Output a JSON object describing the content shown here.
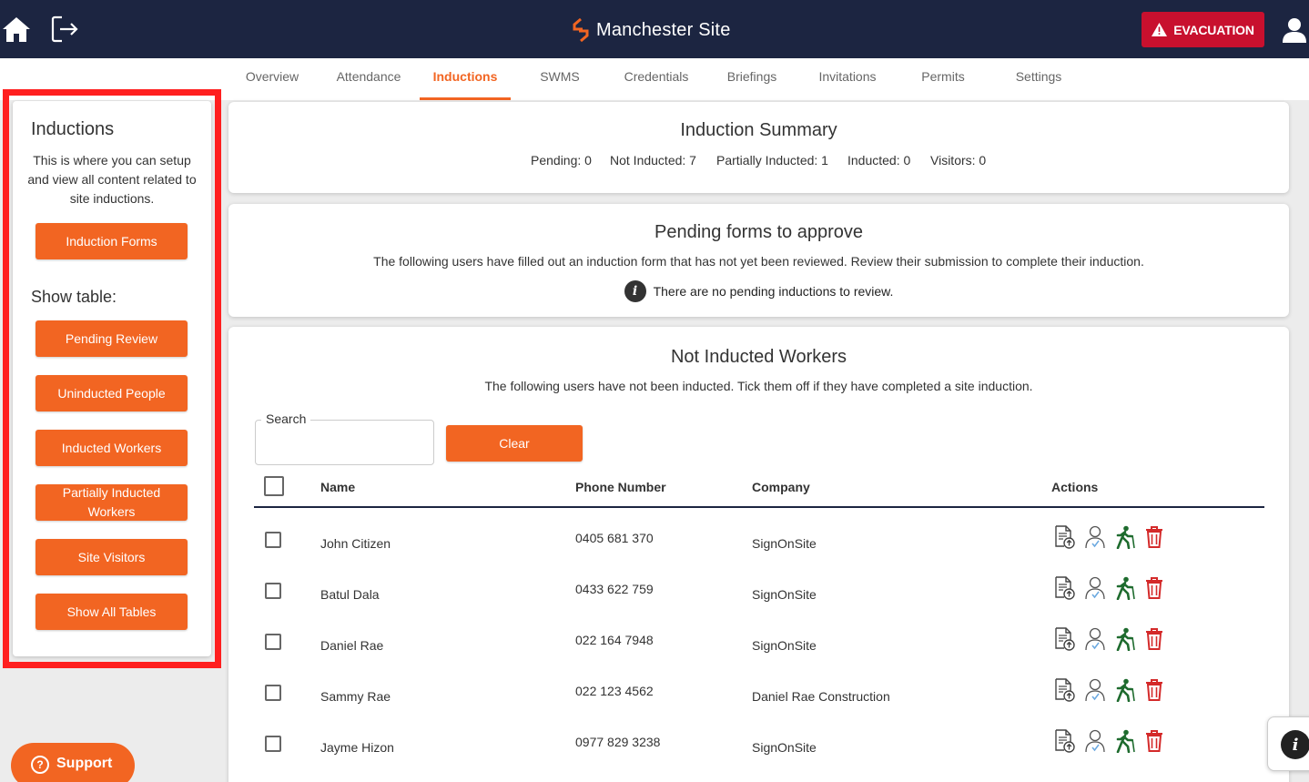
{
  "header": {
    "site_title": "Manchester Site",
    "evacuation_label": "EVACUATION",
    "colors": {
      "navbar": "#1c2541",
      "accent": "#f26522",
      "evacuation": "#c8102e"
    }
  },
  "tabs": [
    {
      "label": "Overview"
    },
    {
      "label": "Attendance"
    },
    {
      "label": "Inductions",
      "active": true
    },
    {
      "label": "SWMS"
    },
    {
      "label": "Credentials"
    },
    {
      "label": "Briefings"
    },
    {
      "label": "Invitations"
    },
    {
      "label": "Permits"
    },
    {
      "label": "Settings"
    }
  ],
  "sidebar": {
    "heading": "Inductions",
    "description": "This is where you can setup and view all content related to site inductions.",
    "induction_forms_label": "Induction Forms",
    "show_table_label": "Show table:",
    "buttons": [
      {
        "label": "Pending Review"
      },
      {
        "label": "Uninducted People"
      },
      {
        "label": "Inducted Workers"
      },
      {
        "label": "Partially Inducted Workers"
      },
      {
        "label": "Site Visitors"
      },
      {
        "label": "Show All Tables"
      }
    ]
  },
  "summary": {
    "title": "Induction Summary",
    "stats": [
      {
        "text": "Pending: 0"
      },
      {
        "text": "Not Inducted: 7"
      },
      {
        "text": "Partially Inducted: 1"
      },
      {
        "text": "Inducted: 0"
      },
      {
        "text": "Visitors: 0"
      }
    ]
  },
  "pending": {
    "title": "Pending forms to approve",
    "subtitle": "The following users have filled out an induction form that has not yet been reviewed. Review their submission to complete their induction.",
    "empty_message": "There are no pending inductions to review."
  },
  "not_inducted": {
    "title": "Not Inducted Workers",
    "subtitle": "The following users have not been inducted. Tick them off if they have completed a site induction.",
    "search_label": "Search",
    "search_value": "",
    "clear_label": "Clear",
    "columns": {
      "name": "Name",
      "phone": "Phone Number",
      "company": "Company",
      "actions": "Actions"
    },
    "rows": [
      {
        "name": "John Citizen",
        "phone": "0405 681 370",
        "company": "SignOnSite"
      },
      {
        "name": "Batul Dala",
        "phone": "0433 622 759",
        "company": "SignOnSite"
      },
      {
        "name": "Daniel Rae",
        "phone": "022 164 7948",
        "company": "SignOnSite"
      },
      {
        "name": "Sammy Rae",
        "phone": "022 123 4562",
        "company": "Daniel Rae Construction"
      },
      {
        "name": "Jayme Hizon",
        "phone": "0977 829 3238",
        "company": "SignOnSite"
      }
    ],
    "action_icons": [
      "upload-document-icon",
      "user-check-icon",
      "walking-person-icon",
      "trash-icon"
    ]
  },
  "support": {
    "label": "Support"
  }
}
